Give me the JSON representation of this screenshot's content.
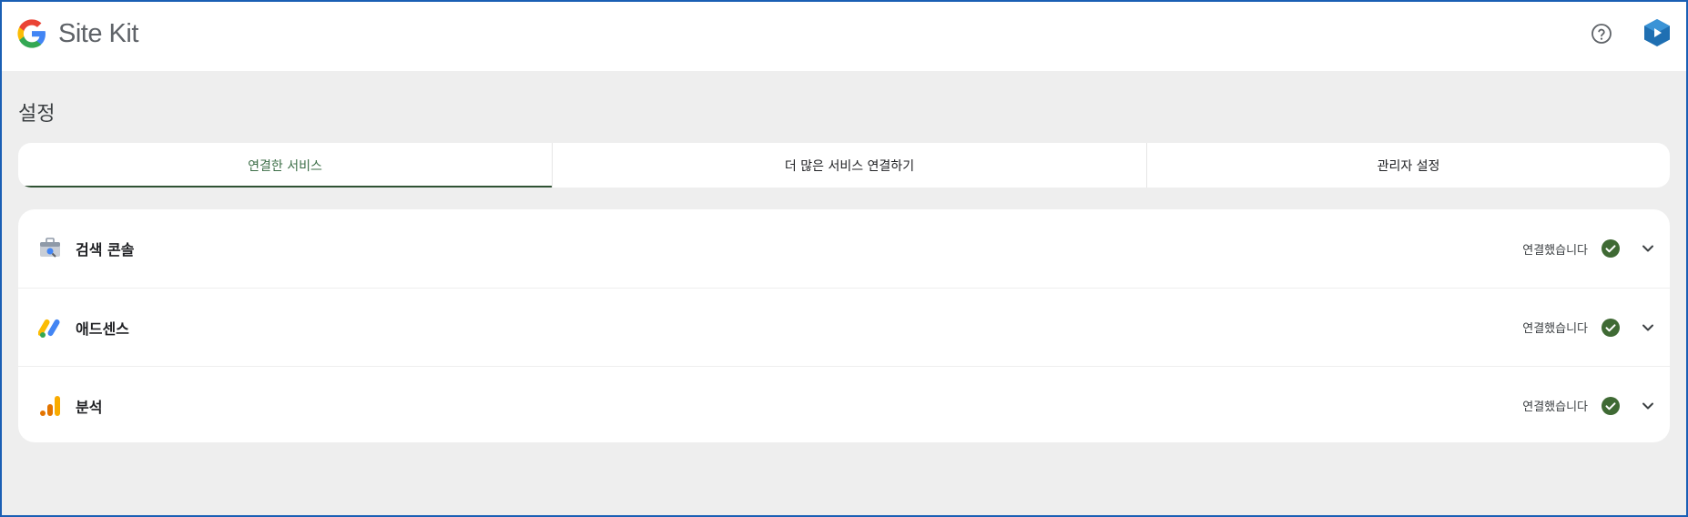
{
  "header": {
    "brand_text": "Site Kit",
    "help_icon": "help-circle-icon",
    "avatar_icon": "account-avatar-icon"
  },
  "page": {
    "title": "설정"
  },
  "tabs": [
    {
      "label": "연결한 서비스",
      "active": true
    },
    {
      "label": "더 많은 서비스 연결하기",
      "active": false
    },
    {
      "label": "관리자 설정",
      "active": false
    }
  ],
  "services": [
    {
      "name": "검색 콘솔",
      "status": "연결했습니다",
      "icon": "search-console-icon"
    },
    {
      "name": "애드센스",
      "status": "연결했습니다",
      "icon": "adsense-icon"
    },
    {
      "name": "분석",
      "status": "연결했습니다",
      "icon": "analytics-icon"
    }
  ],
  "colors": {
    "accent": "#2f5233",
    "connected_check": "#3f6a34",
    "background": "#eeeeee",
    "card": "#ffffff"
  }
}
